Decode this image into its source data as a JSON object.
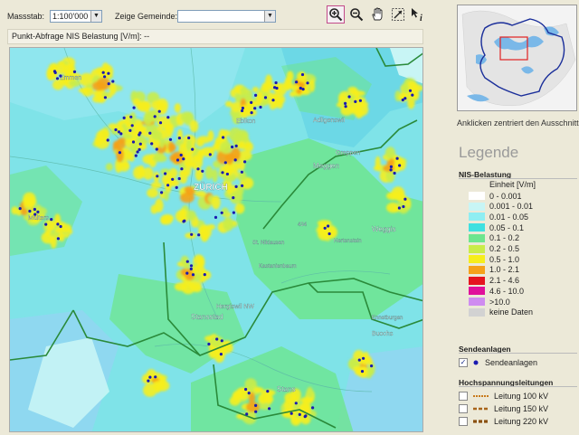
{
  "toolbar": {
    "scale_label": "Massstab:",
    "scale_value": "1:100'000",
    "municipality_label": "Zeige Gemeinde:",
    "municipality_value": ""
  },
  "status_text": "Punkt-Abfrage NIS Belastung [V/m]: --",
  "map_labels": {
    "zurich": "ZÜRICH",
    "maggen": "Meggen",
    "greppen": "Greppen",
    "weggis": "Weggis",
    "hertenstein": "Hertenstein",
    "kastanienbaum": "Kastanienbaum",
    "stansstad": "Stansstad",
    "buochs": "Buochs",
    "ennetburgen": "Ennetburgen",
    "stans": "Stans",
    "ebikon": "Ebikon",
    "adligenswil": "Adligenswil",
    "emmen": "Emmen",
    "malters": "Malters",
    "hergiswil": "Hergiswil NW",
    "st_niklausen": "St. Niklausen",
    "elev_434": "434"
  },
  "overview_caption": "Anklicken zentriert den Ausschnitt",
  "legend": {
    "title": "Legende",
    "nis_heading": "NIS-Belastung",
    "unit": "Einheit [V/m]",
    "classes": [
      {
        "label": "0 - 0.001",
        "color": "#ffffff"
      },
      {
        "label": "0.001 - 0.01",
        "color": "#c8f5f5"
      },
      {
        "label": "0.01 - 0.05",
        "color": "#8feef2"
      },
      {
        "label": "0.05 - 0.1",
        "color": "#3fe0e0"
      },
      {
        "label": "0.1 - 0.2",
        "color": "#6de58e"
      },
      {
        "label": "0.2 - 0.5",
        "color": "#c9ec49"
      },
      {
        "label": "0.5 - 1.0",
        "color": "#f6ee1c"
      },
      {
        "label": "1.0 - 2.1",
        "color": "#f5a21a"
      },
      {
        "label": "2.1 - 4.6",
        "color": "#e5141f"
      },
      {
        "label": "4.6 - 10.0",
        "color": "#e0109a"
      },
      {
        "label": ">10.0",
        "color": "#cf8cf0"
      },
      {
        "label": "keine Daten",
        "color": "#d2d2d2"
      }
    ],
    "senders_heading": "Sendeanlagen",
    "senders_label": "Sendeanlagen",
    "senders_checked": true,
    "senders_dot_color": "#1a1ab0",
    "powerlines_heading": "Hochspannungsleitungen",
    "powerlines": [
      {
        "label": "Leitung 100 kV",
        "color": "#c87a1c"
      },
      {
        "label": "Leitung 150 kV",
        "color": "#a8641a"
      },
      {
        "label": "Leitung 220 kV",
        "color": "#8a5010"
      }
    ]
  },
  "icons": {
    "zoom_in": "zoom-in-icon",
    "zoom_out": "zoom-out-icon",
    "pan": "hand-pan-icon",
    "zoom_box": "zoom-box-icon",
    "info": "info-icon"
  }
}
